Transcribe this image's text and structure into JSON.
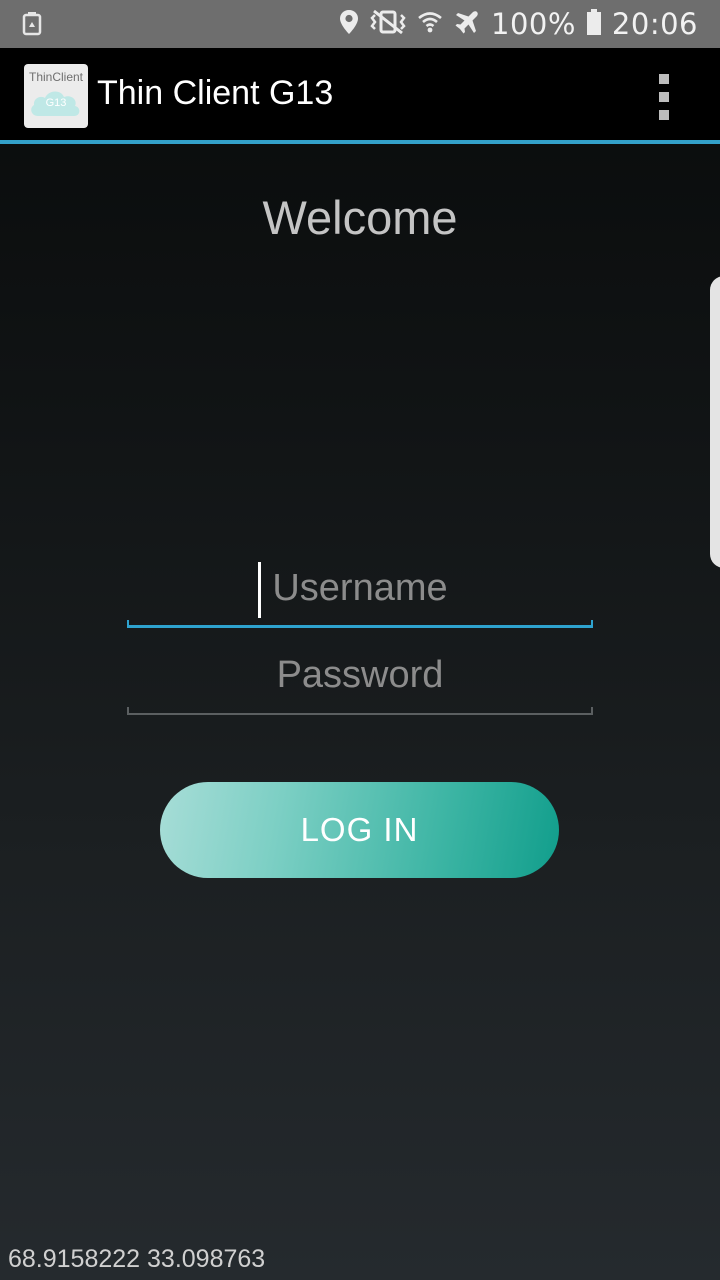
{
  "status_bar": {
    "battery_percent": "100%",
    "time": "20:06",
    "icons": [
      "recycle-icon",
      "location-icon",
      "vibrate-off-icon",
      "wifi-icon",
      "airplane-mode-icon",
      "battery-icon"
    ]
  },
  "app_bar": {
    "logo_text": "ThinClient",
    "logo_sub": "G13",
    "title": "Thin Client G13",
    "menu_icon": "overflow-menu-icon"
  },
  "login": {
    "welcome": "Welcome",
    "username_value": "",
    "username_placeholder": "Username",
    "password_value": "",
    "password_placeholder": "Password",
    "button_label": "LOG IN"
  },
  "footer": {
    "coordinates": "68.9158222 33.098763"
  },
  "colors": {
    "accent": "#33a1c9",
    "button_start": "#a7ddd7",
    "button_end": "#119e8c",
    "status_bar": "#6e6e6e",
    "app_bar": "#000000"
  }
}
